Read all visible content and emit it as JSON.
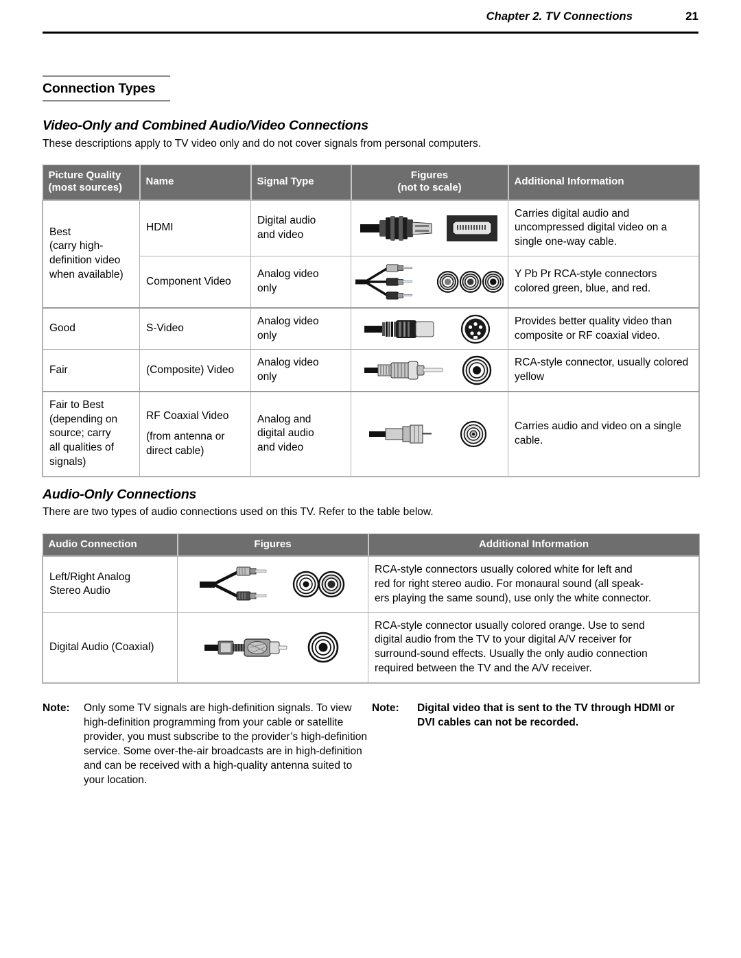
{
  "running_head": {
    "chapter": "Chapter 2. TV Connections",
    "page_number": "21"
  },
  "headings": {
    "section_title": "Connection Types",
    "video_subtitle": "Video-Only and Combined Audio/Video Connections",
    "video_intro": "These descriptions apply to TV video only and do not cover signals from personal computers.",
    "audio_subtitle": "Audio-Only Connections",
    "audio_intro": "There are two types of audio connections used on this TV.  Refer to the table below."
  },
  "video_table": {
    "columns": [
      "Picture Quality",
      "(most sources)",
      "Name",
      "Signal Type",
      "Figures",
      "(not to scale)",
      "Additional Information"
    ],
    "headers": {
      "quality_line1": "Picture Quality",
      "quality_line2": "(most sources)",
      "name": "Name",
      "signal_type": "Signal Type",
      "figures_line1": "Figures",
      "figures_line2": "(not to scale)",
      "additional_information": "Additional Information"
    },
    "rows": [
      {
        "quality": "Best\n(carry high-\ndefinition video\nwhen available)",
        "quality_rowspan": 2,
        "name": "HDMI",
        "signal_type": "Digital audio\nand video",
        "figure": "hdmi-connector-and-port",
        "info": "Carries digital audio and uncompressed digital video on a single one-way cable."
      },
      {
        "name": "Component Video",
        "signal_type": "Analog video\nonly",
        "figure": "component-video-triple-rca-and-jacks",
        "info": "Y Pb Pr RCA-style connectors colored green, blue, and red."
      },
      {
        "quality": "Good",
        "name": "S-Video",
        "signal_type": "Analog video\nonly",
        "figure": "s-video-connector-and-jack",
        "info": "Provides better quality video than composite or RF coaxial video."
      },
      {
        "quality": "Fair",
        "name": "(Composite) Video",
        "signal_type": "Analog video\nonly",
        "figure": "composite-rca-connector-and-jack",
        "info": "RCA-style connector, usually colored yellow"
      },
      {
        "quality": "Fair to Best\n(depending on\nsource; carry\nall qualities of\nsignals)",
        "name": "RF Coaxial Video",
        "name_sub": "(from antenna or\ndirect cable)",
        "signal_type": "Analog and\ndigital audio\nand video",
        "figure": "rf-coaxial-connector-and-jack",
        "info": "Carries audio and video on a single cable."
      }
    ]
  },
  "audio_table": {
    "headers": {
      "audio_connection": "Audio Connection",
      "figures": "Figures",
      "additional_information": "Additional Information"
    },
    "rows": [
      {
        "connection": "Left/Right Analog\nStereo Audio",
        "figure": "stereo-rca-pair-and-jacks",
        "info": "RCA-style connectors usually colored white for left and red for right stereo audio.  For monaural sound (all speak-ers playing the same sound), use only the white connector."
      },
      {
        "connection": "Digital Audio (Coaxial)",
        "figure": "digital-coaxial-rca-connector-and-jack",
        "info": "RCA-style connector usually colored orange.  Use to send digital audio from the TV to your digital A/V receiver for surround-sound effects. Usually the only audio connection required between the TV and the A/V receiver."
      }
    ]
  },
  "notes": {
    "left": {
      "label": "Note:",
      "text": "Only some TV signals are high-definition signals. To view high-definition programming from your cable or satellite provider, you must subscribe to the provider’s high-definition service.  Some over-the-air broadcasts are in high-definition and can be received with a high-quality antenna suited to your location."
    },
    "right": {
      "label": "Note:",
      "text": "Digital video that is sent to the TV through HDMI or DVI cables can not be recorded."
    }
  },
  "colors": {
    "header_gray": "#6e6e6e",
    "border_gray": "#b0b0b0",
    "rule_black": "#000000",
    "heading_rule": "#8a8a8a"
  }
}
